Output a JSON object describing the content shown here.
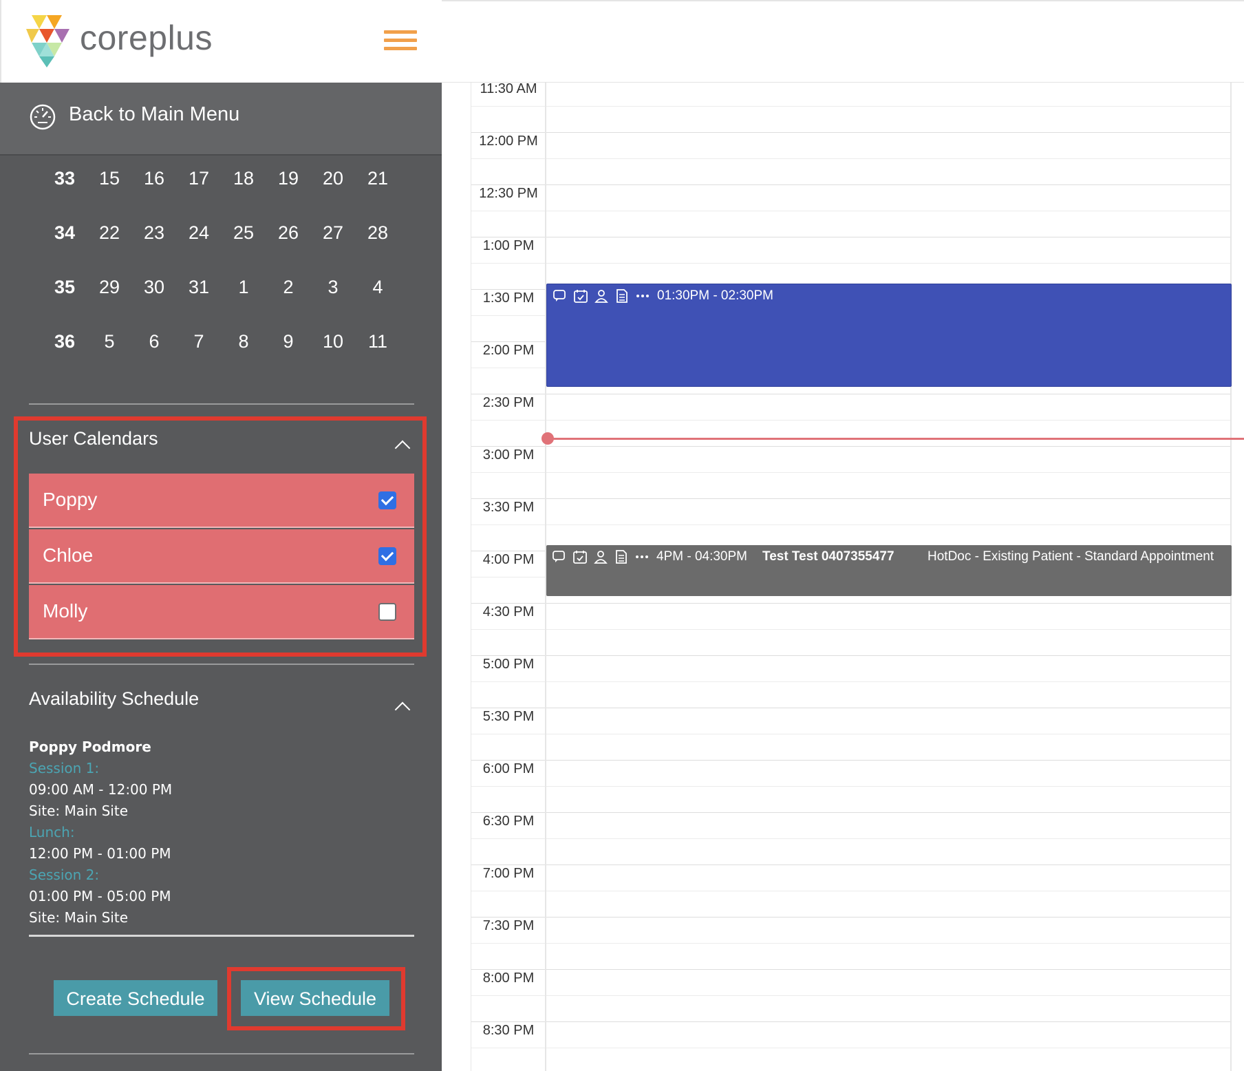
{
  "app": {
    "logo_text": "coreplus"
  },
  "sidebar": {
    "back_label": "Back to Main Menu",
    "calendar_rows": [
      [
        "33",
        "15",
        "16",
        "17",
        "18",
        "19",
        "20",
        "21"
      ],
      [
        "34",
        "22",
        "23",
        "24",
        "25",
        "26",
        "27",
        "28"
      ],
      [
        "35",
        "29",
        "30",
        "31",
        "1",
        "2",
        "3",
        "4"
      ],
      [
        "36",
        "5",
        "6",
        "7",
        "8",
        "9",
        "10",
        "11"
      ]
    ],
    "user_calendars": {
      "title": "User Calendars",
      "items": [
        {
          "label": "Poppy",
          "checked": true
        },
        {
          "label": "Chloe",
          "checked": true
        },
        {
          "label": "Molly",
          "checked": false
        }
      ]
    },
    "availability": {
      "title": "Availability Schedule",
      "name": "Poppy Podmore",
      "session1_label": "Session 1:",
      "session1_time": "09:00 AM - 12:00 PM",
      "session1_site": "Site: Main Site",
      "lunch_label": "Lunch:",
      "lunch_time": "12:00 PM - 01:00 PM",
      "session2_label": "Session 2:",
      "session2_time": "01:00 PM - 05:00 PM",
      "session2_site": "Site: Main Site"
    },
    "buttons": {
      "create": "Create Schedule",
      "view": "View Schedule"
    }
  },
  "calendar": {
    "times": [
      "11:30 AM",
      "12:00 PM",
      "12:30 PM",
      "1:00 PM",
      "1:30 PM",
      "2:00 PM",
      "2:30 PM",
      "3:00 PM",
      "3:30 PM",
      "4:00 PM",
      "4:30 PM",
      "5:00 PM",
      "5:30 PM",
      "6:00 PM",
      "6:30 PM",
      "7:00 PM",
      "7:30 PM",
      "8:00 PM",
      "8:30 PM"
    ],
    "appointments": [
      {
        "time": "01:30PM - 02:30PM",
        "name": "",
        "desc": ""
      },
      {
        "time": "4PM - 04:30PM",
        "name": "Test Test 0407355477",
        "desc": "HotDoc - Existing Patient - Standard Appointment"
      }
    ]
  },
  "colors": {
    "sidebar_bg": "#58595b",
    "user_calendar_item": "#e06e72",
    "highlight_border": "#e03a2f",
    "button": "#4a9ba8",
    "appointment_blue": "#3f51b5",
    "appointment_grey": "#6b6b6b",
    "now_line": "#e07278",
    "accent_menu": "#f1a04b"
  }
}
